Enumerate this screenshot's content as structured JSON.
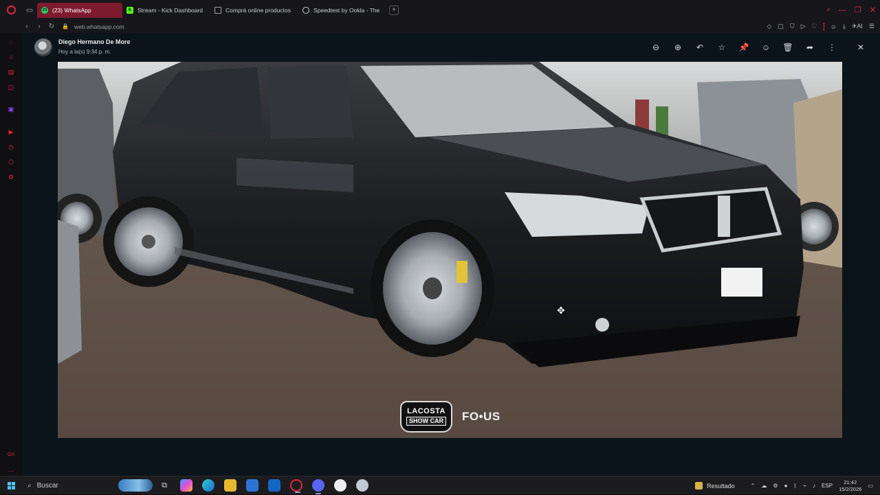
{
  "browser": {
    "tabs": [
      {
        "label": "(23) WhatsApp",
        "badge": "23",
        "icon": "whatsapp-icon",
        "active": true
      },
      {
        "label": "Stream - Kick Dashboard",
        "icon": "kick-icon",
        "active": false
      },
      {
        "label": "Comprá online productos",
        "icon": "document-icon",
        "active": false
      },
      {
        "label": "Speedtest by Ookla - The",
        "icon": "speedtest-icon",
        "active": false
      }
    ],
    "url": "web.whatsapp.com",
    "accent": "#e0243c"
  },
  "viewer": {
    "sender": "Diego Hermano De More",
    "timestamp": "Hoy a la(s) 9:34 p. m.",
    "actions": [
      "zoom-out",
      "zoom-in",
      "reply",
      "star",
      "pin",
      "react",
      "delete",
      "forward",
      "more",
      "close"
    ],
    "watermark": {
      "brand1_line1": "LACOSTA",
      "brand1_line2": "SHOW CAR",
      "brand2": "FO•US"
    }
  },
  "taskbar": {
    "search_placeholder": "Buscar",
    "weather": "Resultado",
    "language": "ESP",
    "time": "21:42",
    "date": "15/2/2026"
  }
}
